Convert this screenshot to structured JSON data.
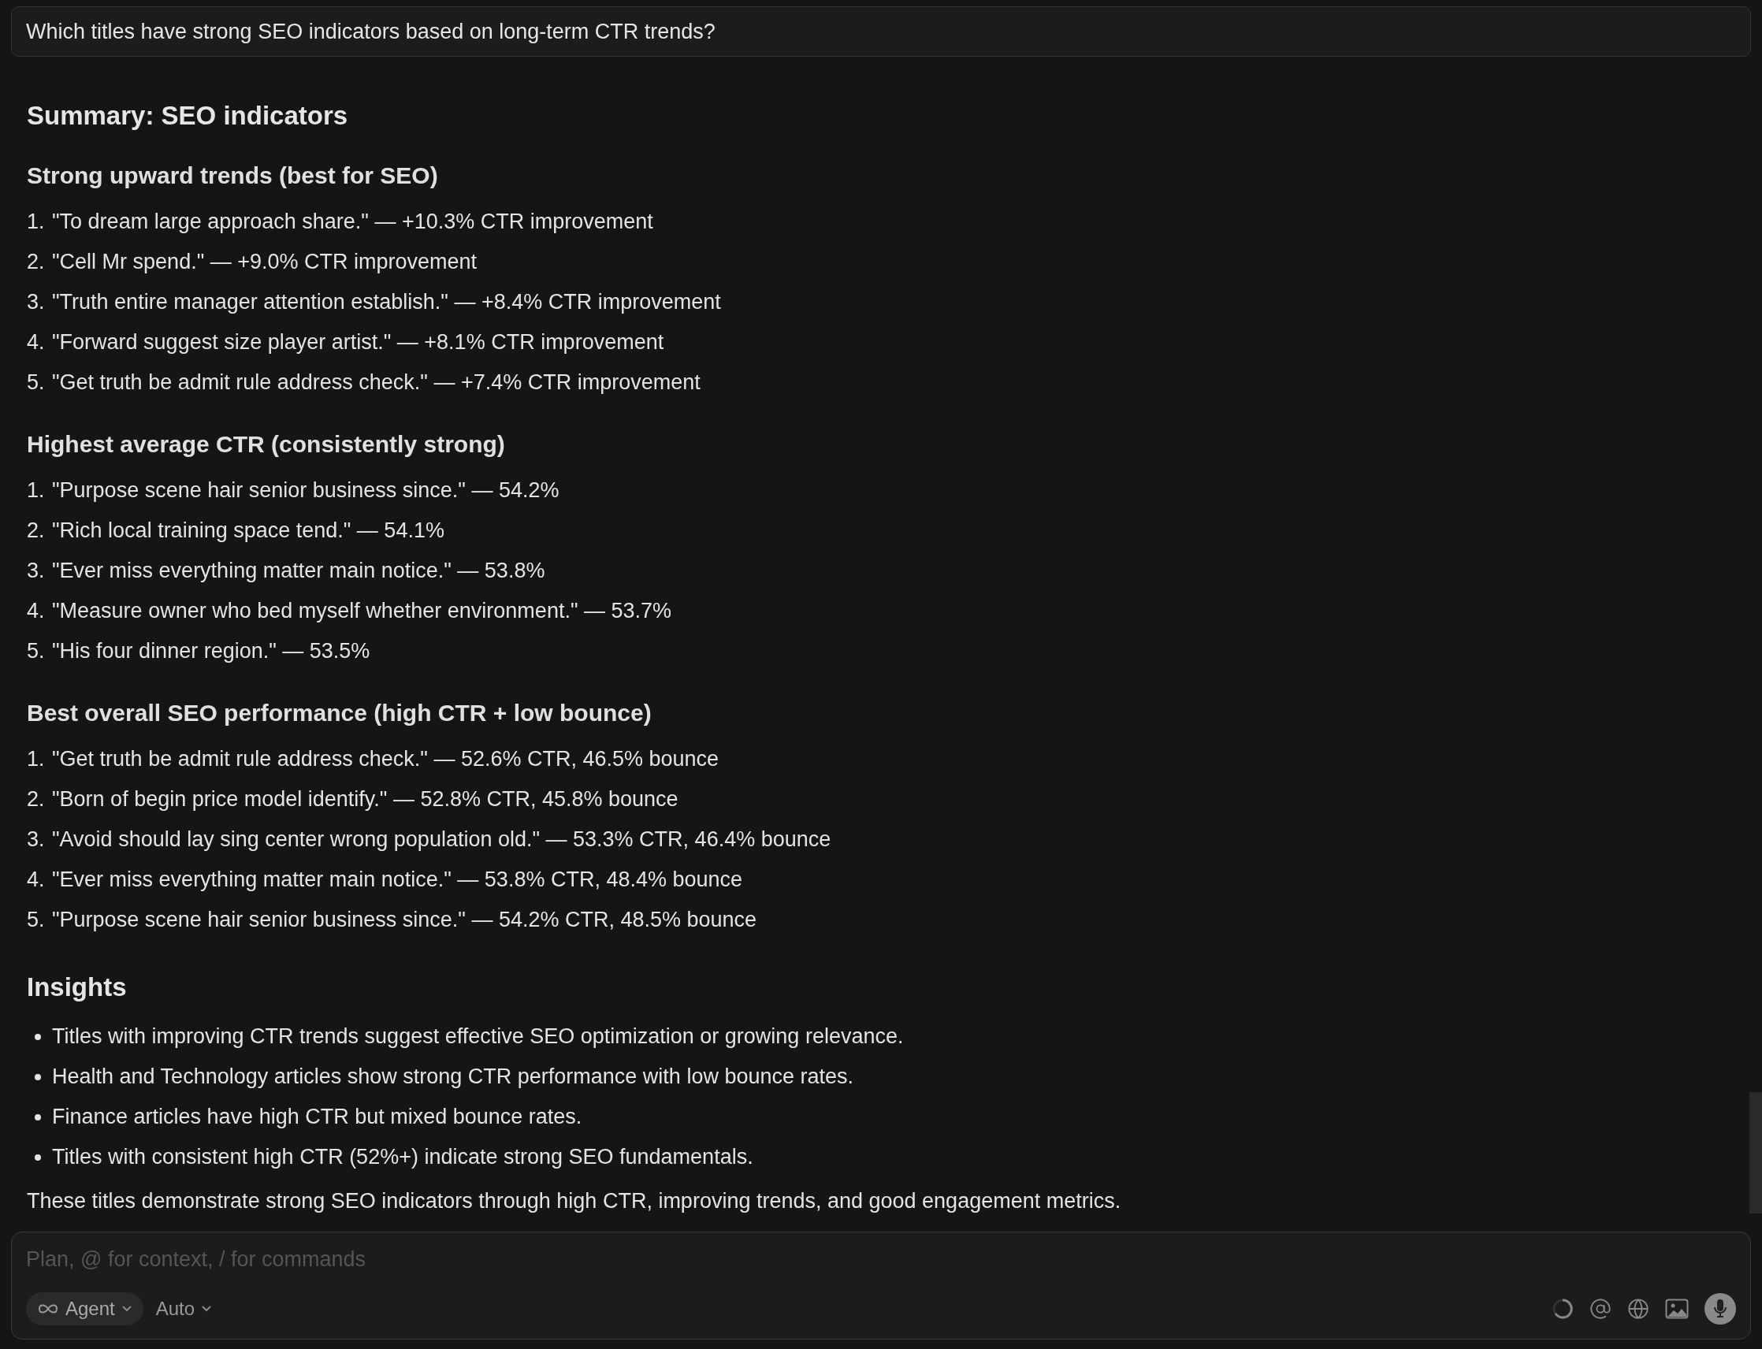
{
  "question": "Which titles have strong SEO indicators based on long-term CTR trends?",
  "blocks": [
    {
      "kind": "heading2",
      "text": "Summary: SEO indicators"
    },
    {
      "kind": "heading3",
      "text": "Strong upward trends (best for SEO)"
    },
    {
      "kind": "ordered",
      "items": [
        {
          "number": "1.",
          "text": "\"To dream large approach share.\" — +10.3% CTR improvement"
        },
        {
          "number": "2.",
          "text": "\"Cell Mr spend.\" — +9.0% CTR improvement"
        },
        {
          "number": "3.",
          "text": "\"Truth entire manager attention establish.\" — +8.4% CTR improvement"
        },
        {
          "number": "4.",
          "text": "\"Forward suggest size player artist.\" — +8.1% CTR improvement"
        },
        {
          "number": "5.",
          "text": "\"Get truth be admit rule address check.\" — +7.4% CTR improvement"
        }
      ]
    },
    {
      "kind": "heading3",
      "text": "Highest average CTR (consistently strong)"
    },
    {
      "kind": "ordered",
      "items": [
        {
          "number": "1.",
          "text": "\"Purpose scene hair senior business since.\" — 54.2%"
        },
        {
          "number": "2.",
          "text": "\"Rich local training space tend.\" — 54.1%"
        },
        {
          "number": "3.",
          "text": "\"Ever miss everything matter main notice.\" — 53.8%"
        },
        {
          "number": "4.",
          "text": "\"Measure owner who bed myself whether environment.\" — 53.7%"
        },
        {
          "number": "5.",
          "text": "\"His four dinner region.\" — 53.5%"
        }
      ]
    },
    {
      "kind": "heading3",
      "text": "Best overall SEO performance (high CTR + low bounce)"
    },
    {
      "kind": "ordered",
      "items": [
        {
          "number": "1.",
          "text": "\"Get truth be admit rule address check.\" — 52.6% CTR, 46.5% bounce"
        },
        {
          "number": "2.",
          "text": "\"Born of begin price model identify.\" — 52.8% CTR, 45.8% bounce"
        },
        {
          "number": "3.",
          "text": "\"Avoid should lay sing center wrong population old.\" — 53.3% CTR, 46.4% bounce"
        },
        {
          "number": "4.",
          "text": "\"Ever miss everything matter main notice.\" — 53.8% CTR, 48.4% bounce"
        },
        {
          "number": "5.",
          "text": "\"Purpose scene hair senior business since.\" — 54.2% CTR, 48.5% bounce"
        }
      ]
    },
    {
      "kind": "heading2",
      "text": "Insights"
    },
    {
      "kind": "bullets",
      "items": [
        {
          "text": "Titles with improving CTR trends suggest effective SEO optimization or growing relevance."
        },
        {
          "text": "Health and Technology articles show strong CTR performance with low bounce rates."
        },
        {
          "text": "Finance articles have high CTR but mixed bounce rates."
        },
        {
          "text": "Titles with consistent high CTR (52%+) indicate strong SEO fundamentals."
        }
      ]
    },
    {
      "kind": "paragraph",
      "text": "These titles demonstrate strong SEO indicators through high CTR, improving trends, and good engagement metrics."
    }
  ],
  "composer": {
    "placeholder": "Plan, @ for context, / for commands",
    "mode": "Agent",
    "model": "Auto"
  }
}
